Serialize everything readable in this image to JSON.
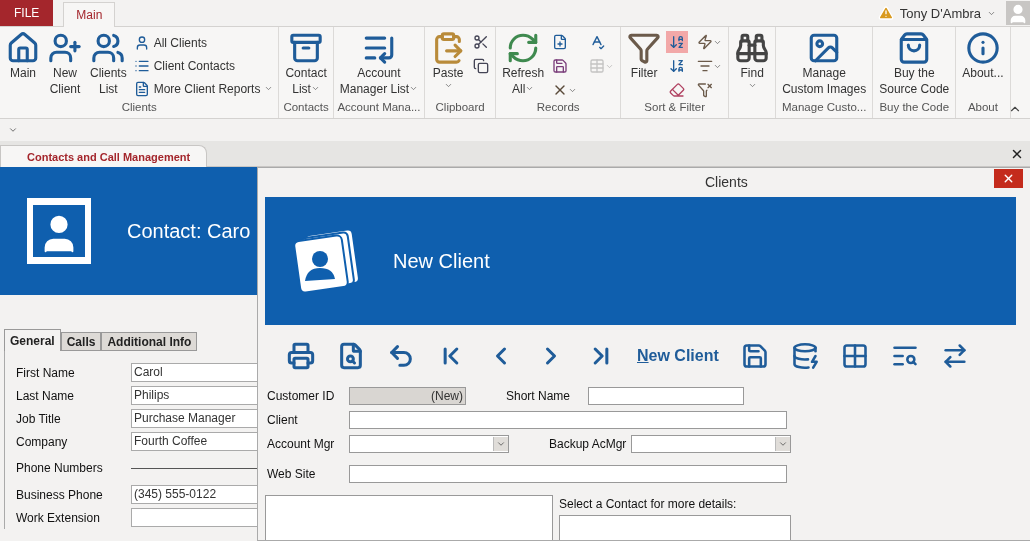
{
  "title_bar": {
    "user": "Tony D'Ambra"
  },
  "ribbon_tabs": [
    {
      "label": "FILE",
      "kind": "file",
      "selected": false
    },
    {
      "label": "Main",
      "kind": "tab",
      "selected": true
    }
  ],
  "ribbon_groups": [
    {
      "label": "Clients",
      "items": [
        {
          "kind": "large",
          "lines": [
            "Main"
          ]
        },
        {
          "kind": "large",
          "lines": [
            "New",
            "Client"
          ]
        },
        {
          "kind": "large",
          "lines": [
            "Clients",
            "List"
          ]
        },
        {
          "kind": "stack",
          "entries": [
            {
              "label": "All Clients",
              "dropdown": false
            },
            {
              "label": "Client Contacts",
              "dropdown": false
            },
            {
              "label": "More Client Reports",
              "dropdown": true
            }
          ]
        }
      ]
    },
    {
      "label": "Contacts",
      "items": [
        {
          "kind": "large",
          "lines": [
            "Contact",
            "List"
          ],
          "dropdown": true
        }
      ]
    },
    {
      "label": "Account Mana...",
      "items": [
        {
          "kind": "large",
          "lines": [
            "Account",
            "Manager List"
          ],
          "dropdown": true
        }
      ]
    },
    {
      "label": "Clipboard",
      "items": [
        {
          "kind": "large",
          "lines": [
            "Paste"
          ],
          "dropdown": true
        },
        {
          "kind": "cells",
          "columns": [
            [
              {
                "dropdown": false
              },
              {
                "dropdown": false
              }
            ]
          ]
        }
      ]
    },
    {
      "label": "Records",
      "items": [
        {
          "kind": "large",
          "lines": [
            "Refresh",
            "All"
          ],
          "dropdown": true
        },
        {
          "kind": "cells",
          "columns": [
            [
              {
                "dropdown": false,
                "disabled": false
              },
              {
                "dropdown": false,
                "disabled": false
              },
              {
                "dropdown": true,
                "disabled": false
              }
            ],
            [
              {
                "dropdown": false,
                "disabled": false
              },
              {
                "dropdown": true,
                "disabled": true
              }
            ]
          ]
        }
      ]
    },
    {
      "label": "Sort & Filter",
      "items": [
        {
          "kind": "large",
          "lines": [
            "Filter"
          ]
        },
        {
          "kind": "cells",
          "columns": [
            [
              {
                "dropdown": false,
                "active": true
              },
              {
                "dropdown": false,
                "active": false
              },
              {
                "dropdown": false,
                "active": false
              }
            ],
            [
              {
                "dropdown": true,
                "active": false
              },
              {
                "dropdown": true,
                "active": false
              },
              {
                "dropdown": false,
                "active": false
              }
            ]
          ]
        }
      ]
    },
    {
      "items": [
        {
          "kind": "large",
          "lines": [
            "Find"
          ],
          "dropdown": true
        }
      ]
    },
    {
      "label": "Manage Custo...",
      "items": [
        {
          "kind": "large",
          "lines": [
            "Manage",
            "Custom Images"
          ]
        }
      ]
    },
    {
      "label": "Buy the Code",
      "items": [
        {
          "kind": "large",
          "lines": [
            "Buy the",
            "Source Code"
          ]
        }
      ]
    },
    {
      "label": "About",
      "items": [
        {
          "kind": "large",
          "lines": [
            "About..."
          ]
        }
      ]
    }
  ],
  "document_tabs": [
    {
      "label": "Contacts and Call Management",
      "selected": true
    }
  ],
  "contact_form": {
    "title": "Contact: Caro",
    "tabs": [
      {
        "label": "General",
        "selected": true
      },
      {
        "label": "Calls",
        "selected": false
      },
      {
        "label": "Additional Info",
        "selected": false
      }
    ],
    "fields": [
      {
        "kind": "field",
        "label": "First Name",
        "value": "Carol"
      },
      {
        "kind": "field",
        "label": "Last Name",
        "value": "Philips"
      },
      {
        "kind": "field",
        "label": "Job Title",
        "value": "Purchase Manager"
      },
      {
        "kind": "field",
        "label": "Company",
        "value": "Fourth Coffee"
      },
      {
        "kind": "section",
        "label": "Phone Numbers"
      },
      {
        "kind": "field",
        "label": "Business Phone",
        "value": "(345) 555-0122"
      },
      {
        "kind": "field",
        "label": "Work Extension"
      }
    ]
  },
  "clients_window": {
    "title": "Clients",
    "header": "New Client",
    "toolbar_button": "New Client",
    "rows": [
      [
        {
          "label": "Customer ID",
          "kind": "readonly",
          "value": "(New)"
        },
        {
          "label": "Short Name",
          "kind": "text"
        }
      ],
      [
        {
          "label": "Client",
          "kind": "text"
        }
      ],
      [
        {
          "label": "Account Mgr",
          "kind": "combo"
        },
        {
          "label": "Backup AcMgr",
          "kind": "combo"
        }
      ],
      [
        {
          "label": "Web Site",
          "kind": "text"
        }
      ]
    ],
    "contact_prompt": "Select a Contact for more details:"
  }
}
